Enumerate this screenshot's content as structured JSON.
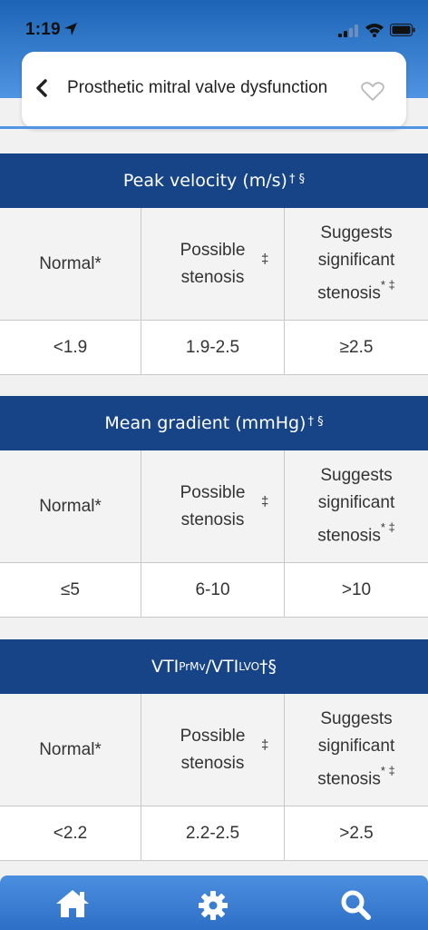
{
  "status": {
    "time": "1:19"
  },
  "header": {
    "title": "Prosthetic mitral valve dysfunction"
  },
  "columns": {
    "normal": "Normal*",
    "possible_line1": "Possible",
    "possible_line2": "stenosis",
    "possible_mark": "‡",
    "suggests_line1": "Suggests",
    "suggests_line2": "significant",
    "suggests_line3": "stenosis",
    "suggests_mark": "* ‡"
  },
  "sections": [
    {
      "title": "Peak velocity (m/s)",
      "title_marks": "† §",
      "values": [
        "<1.9",
        "1.9-2.5",
        "≥2.5"
      ]
    },
    {
      "title": "Mean gradient (mmHg)",
      "title_marks": "† §",
      "values": [
        "≤5",
        "6-10",
        ">10"
      ]
    },
    {
      "title_part1": "VTI",
      "title_sub1": "PrMv",
      "title_part2": "/VTI",
      "title_sub2": "LVO",
      "title_marks": "†§",
      "values": [
        "<2.2",
        "2.2-2.5",
        ">2.5"
      ]
    }
  ],
  "nav": {
    "icons": [
      "home-icon",
      "gear-icon",
      "search-icon"
    ]
  },
  "colors": {
    "header_blue": "#164486",
    "accent_blue": "#4f95e3"
  }
}
